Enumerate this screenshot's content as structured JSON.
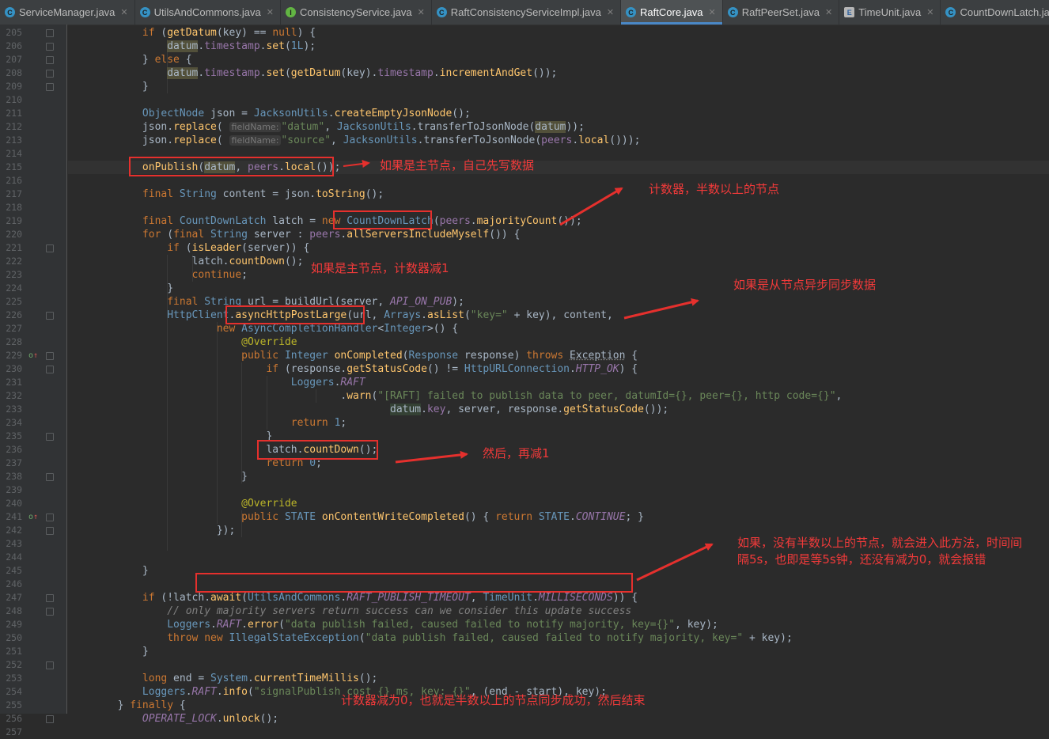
{
  "tabs": [
    {
      "name": "ServiceManager.java",
      "icon": "class",
      "active": false
    },
    {
      "name": "UtilsAndCommons.java",
      "icon": "class",
      "active": false
    },
    {
      "name": "ConsistencyService.java",
      "icon": "iface",
      "active": false
    },
    {
      "name": "RaftConsistencyServiceImpl.java",
      "icon": "class",
      "active": false
    },
    {
      "name": "RaftCore.java",
      "icon": "class",
      "active": true
    },
    {
      "name": "RaftPeerSet.java",
      "icon": "class",
      "active": false
    },
    {
      "name": "TimeUnit.java",
      "icon": "enum",
      "active": false
    },
    {
      "name": "CountDownLatch.java",
      "icon": "class",
      "active": false
    }
  ],
  "line_numbers": [
    "205",
    "206",
    "207",
    "208",
    "209",
    "210",
    "211",
    "212",
    "213",
    "214",
    "215",
    "216",
    "217",
    "218",
    "219",
    "220",
    "221",
    "222",
    "223",
    "224",
    "225",
    "226",
    "227",
    "228",
    "229",
    "230",
    "231",
    "232",
    "233",
    "234",
    "235",
    "236",
    "237",
    "238",
    "239",
    "240",
    "241",
    "242",
    "243",
    "244",
    "245",
    "246",
    "247",
    "248",
    "249",
    "250",
    "251",
    "252",
    "253",
    "254",
    "255",
    "256",
    "257"
  ],
  "code_lines": [
    [
      [
        "",
        "            "
      ],
      [
        "k",
        "if"
      ],
      [
        "",
        " ("
      ],
      [
        "m",
        "getDatum"
      ],
      [
        "",
        "(key) == "
      ],
      [
        "k",
        "null"
      ],
      [
        "",
        ") {"
      ]
    ],
    [
      [
        "",
        "                "
      ],
      [
        "hl",
        "datum"
      ],
      [
        "",
        "."
      ],
      [
        "f",
        "timestamp"
      ],
      [
        "",
        "."
      ],
      [
        "m",
        "set"
      ],
      [
        "",
        "("
      ],
      [
        "n",
        "1L"
      ],
      [
        "",
        ");"
      ]
    ],
    [
      [
        "",
        "            } "
      ],
      [
        "k",
        "else"
      ],
      [
        "",
        " {"
      ]
    ],
    [
      [
        "",
        "                "
      ],
      [
        "hl",
        "datum"
      ],
      [
        "",
        "."
      ],
      [
        "f",
        "timestamp"
      ],
      [
        "",
        "."
      ],
      [
        "m",
        "set"
      ],
      [
        "",
        "("
      ],
      [
        "m",
        "getDatum"
      ],
      [
        "",
        "(key)."
      ],
      [
        "f",
        "timestamp"
      ],
      [
        "",
        "."
      ],
      [
        "m",
        "incrementAndGet"
      ],
      [
        "",
        "());"
      ]
    ],
    [
      [
        "",
        "            }"
      ]
    ],
    [],
    [
      [
        "",
        "            "
      ],
      [
        "t",
        "ObjectNode"
      ],
      [
        "",
        " json = "
      ],
      [
        "t",
        "JacksonUtils"
      ],
      [
        "",
        "."
      ],
      [
        "m",
        "createEmptyJsonNode"
      ],
      [
        "",
        "();"
      ]
    ],
    [
      [
        "",
        "            json."
      ],
      [
        "m",
        "replace"
      ],
      [
        "",
        "( "
      ],
      [
        "hint",
        "fieldName:"
      ],
      [
        "",
        ""
      ],
      [
        "s",
        "\"datum\""
      ],
      [
        "",
        ", "
      ],
      [
        "t",
        "JacksonUtils"
      ],
      [
        "",
        ".transferToJsonNode("
      ],
      [
        "hl",
        "datum"
      ],
      [
        "",
        "));"
      ]
    ],
    [
      [
        "",
        "            json."
      ],
      [
        "m",
        "replace"
      ],
      [
        "",
        "( "
      ],
      [
        "hint",
        "fieldName:"
      ],
      [
        "",
        ""
      ],
      [
        "s",
        "\"source\""
      ],
      [
        "",
        ", "
      ],
      [
        "t",
        "JacksonUtils"
      ],
      [
        "",
        ".transferToJsonNode("
      ],
      [
        "f",
        "peers"
      ],
      [
        "",
        "."
      ],
      [
        "m",
        "local"
      ],
      [
        "",
        "()));"
      ]
    ],
    [],
    [
      [
        "",
        "            "
      ],
      [
        "m",
        "onPublish"
      ],
      [
        "",
        "("
      ],
      [
        "hl",
        "datum"
      ],
      [
        "",
        ", "
      ],
      [
        "f",
        "peers"
      ],
      [
        "",
        "."
      ],
      [
        "m",
        "local"
      ],
      [
        "",
        "());"
      ]
    ],
    [],
    [
      [
        "",
        "            "
      ],
      [
        "k",
        "final"
      ],
      [
        "",
        " "
      ],
      [
        "t",
        "String"
      ],
      [
        "",
        " content = json."
      ],
      [
        "m",
        "toString"
      ],
      [
        "",
        "();"
      ]
    ],
    [],
    [
      [
        "",
        "            "
      ],
      [
        "k",
        "final"
      ],
      [
        "",
        " "
      ],
      [
        "t",
        "CountDownLatch"
      ],
      [
        "",
        " latch = "
      ],
      [
        "k",
        "new"
      ],
      [
        "",
        " "
      ],
      [
        "t",
        "CountDownLatch"
      ],
      [
        "",
        "("
      ],
      [
        "f",
        "peers"
      ],
      [
        "",
        "."
      ],
      [
        "m",
        "majorityCount"
      ],
      [
        "",
        "());"
      ]
    ],
    [
      [
        "",
        "            "
      ],
      [
        "k",
        "for"
      ],
      [
        "",
        " ("
      ],
      [
        "k",
        "final"
      ],
      [
        "",
        " "
      ],
      [
        "t",
        "String"
      ],
      [
        "",
        " server : "
      ],
      [
        "f",
        "peers"
      ],
      [
        "",
        "."
      ],
      [
        "m",
        "allServersIncludeMyself"
      ],
      [
        "",
        "()) {"
      ]
    ],
    [
      [
        "",
        "                "
      ],
      [
        "k",
        "if"
      ],
      [
        "",
        " ("
      ],
      [
        "m",
        "isLeader"
      ],
      [
        "",
        "(server)) {"
      ]
    ],
    [
      [
        "",
        "                    latch."
      ],
      [
        "m",
        "countDown"
      ],
      [
        "",
        "();"
      ]
    ],
    [
      [
        "",
        "                    "
      ],
      [
        "k",
        "continue"
      ],
      [
        "",
        ";"
      ]
    ],
    [
      [
        "",
        "                }"
      ]
    ],
    [
      [
        "",
        "                "
      ],
      [
        "k",
        "final"
      ],
      [
        "",
        " "
      ],
      [
        "t",
        "String"
      ],
      [
        "",
        " url = buildUrl(server, "
      ],
      [
        "sf",
        "API_ON_PUB"
      ],
      [
        "",
        ");"
      ]
    ],
    [
      [
        "",
        "                "
      ],
      [
        "t",
        "HttpClient"
      ],
      [
        "",
        "."
      ],
      [
        "m",
        "asyncHttpPostLarge"
      ],
      [
        "",
        "(url, "
      ],
      [
        "t",
        "Arrays"
      ],
      [
        "",
        "."
      ],
      [
        "m",
        "asList"
      ],
      [
        "",
        "("
      ],
      [
        "s",
        "\"key=\""
      ],
      [
        "",
        " + key), content,"
      ]
    ],
    [
      [
        "",
        "                        "
      ],
      [
        "k",
        "new"
      ],
      [
        "",
        " "
      ],
      [
        "t",
        "AsyncCompletionHandler"
      ],
      [
        "",
        "<"
      ],
      [
        "t",
        "Integer"
      ],
      [
        "",
        ">() {"
      ]
    ],
    [
      [
        "",
        "                            "
      ],
      [
        "a",
        "@Override"
      ]
    ],
    [
      [
        "",
        "                            "
      ],
      [
        "k",
        "public"
      ],
      [
        "",
        " "
      ],
      [
        "t",
        "Integer"
      ],
      [
        "",
        " "
      ],
      [
        "m",
        "onCompleted"
      ],
      [
        "",
        "("
      ],
      [
        "t",
        "Response"
      ],
      [
        "",
        " response) "
      ],
      [
        "k",
        "throws"
      ],
      [
        "",
        " "
      ],
      [
        "ex",
        "Exception"
      ],
      [
        "",
        " {"
      ]
    ],
    [
      [
        "",
        "                                "
      ],
      [
        "k",
        "if"
      ],
      [
        "",
        " (response."
      ],
      [
        "m",
        "getStatusCode"
      ],
      [
        "",
        "() != "
      ],
      [
        "t",
        "HttpURLConnection"
      ],
      [
        "",
        "."
      ],
      [
        "sf",
        "HTTP_OK"
      ],
      [
        "",
        ") {"
      ]
    ],
    [
      [
        "",
        "                                    "
      ],
      [
        "t",
        "Loggers"
      ],
      [
        "",
        "."
      ],
      [
        "sf",
        "RAFT"
      ]
    ],
    [
      [
        "",
        "                                            ."
      ],
      [
        "m",
        "warn"
      ],
      [
        "",
        "("
      ],
      [
        "s",
        "\"[RAFT] failed to publish data to peer, datumId={}, peer={}, http code={}\""
      ],
      [
        "",
        ","
      ]
    ],
    [
      [
        "",
        "                                                    "
      ],
      [
        "hl2",
        "datum"
      ],
      [
        "",
        "."
      ],
      [
        "f",
        "key"
      ],
      [
        "",
        ", server, response."
      ],
      [
        "m",
        "getStatusCode"
      ],
      [
        "",
        "());"
      ]
    ],
    [
      [
        "",
        "                                    "
      ],
      [
        "k",
        "return"
      ],
      [
        "",
        " "
      ],
      [
        "n",
        "1"
      ],
      [
        "",
        ";"
      ]
    ],
    [
      [
        "",
        "                                }"
      ]
    ],
    [
      [
        "",
        "                                latch."
      ],
      [
        "m",
        "countDown"
      ],
      [
        "",
        "();"
      ]
    ],
    [
      [
        "",
        "                                "
      ],
      [
        "k",
        "return"
      ],
      [
        "",
        " "
      ],
      [
        "n",
        "0"
      ],
      [
        "",
        ";"
      ]
    ],
    [
      [
        "",
        "                            }"
      ]
    ],
    [],
    [
      [
        "",
        "                            "
      ],
      [
        "a",
        "@Override"
      ]
    ],
    [
      [
        "",
        "                            "
      ],
      [
        "k",
        "public"
      ],
      [
        "",
        " "
      ],
      [
        "t",
        "STATE"
      ],
      [
        "",
        " "
      ],
      [
        "m",
        "onContentWriteCompleted"
      ],
      [
        "",
        "() { "
      ],
      [
        "k",
        "return"
      ],
      [
        "",
        " "
      ],
      [
        "t",
        "STATE"
      ],
      [
        "",
        "."
      ],
      [
        "sf",
        "CONTINUE"
      ],
      [
        "",
        "; }"
      ]
    ],
    [
      [
        "",
        "                        });"
      ]
    ],
    [],
    [],
    [
      [
        "",
        "            }"
      ]
    ],
    [],
    [
      [
        "",
        "            "
      ],
      [
        "k",
        "if"
      ],
      [
        "",
        " (!latch."
      ],
      [
        "m",
        "await"
      ],
      [
        "",
        "("
      ],
      [
        "t",
        "UtilsAndCommons"
      ],
      [
        "",
        "."
      ],
      [
        "sf",
        "RAFT_PUBLISH_TIMEOUT"
      ],
      [
        "",
        ", "
      ],
      [
        "t",
        "TimeUnit"
      ],
      [
        "",
        "."
      ],
      [
        "sf",
        "MILLISECONDS"
      ],
      [
        "",
        ")) {"
      ]
    ],
    [
      [
        "",
        "                "
      ],
      [
        "c",
        "// only majority servers return success can we consider this update success"
      ]
    ],
    [
      [
        "",
        "                "
      ],
      [
        "t",
        "Loggers"
      ],
      [
        "",
        "."
      ],
      [
        "sf",
        "RAFT"
      ],
      [
        "",
        "."
      ],
      [
        "m",
        "error"
      ],
      [
        "",
        "("
      ],
      [
        "s",
        "\"data publish failed, caused failed to notify majority, key={}\""
      ],
      [
        "",
        ", key);"
      ]
    ],
    [
      [
        "",
        "                "
      ],
      [
        "k",
        "throw"
      ],
      [
        "",
        " "
      ],
      [
        "k",
        "new"
      ],
      [
        "",
        " "
      ],
      [
        "t",
        "IllegalStateException"
      ],
      [
        "",
        "("
      ],
      [
        "s",
        "\"data publish failed, caused failed to notify majority, key=\""
      ],
      [
        "",
        " + key);"
      ]
    ],
    [
      [
        "",
        "            }"
      ]
    ],
    [],
    [
      [
        "",
        "            "
      ],
      [
        "k",
        "long"
      ],
      [
        "",
        " end = "
      ],
      [
        "t",
        "System"
      ],
      [
        "",
        "."
      ],
      [
        "m",
        "currentTimeMillis"
      ],
      [
        "",
        "();"
      ]
    ],
    [
      [
        "",
        "            "
      ],
      [
        "t",
        "Loggers"
      ],
      [
        "",
        "."
      ],
      [
        "sf",
        "RAFT"
      ],
      [
        "",
        "."
      ],
      [
        "m",
        "info"
      ],
      [
        "",
        "("
      ],
      [
        "s",
        "\"signalPublish cost {} ms, key: {}\""
      ],
      [
        "",
        ", (end - start), key);"
      ]
    ],
    [
      [
        "",
        "        } "
      ],
      [
        "k",
        "finally"
      ],
      [
        "",
        " {"
      ]
    ],
    [
      [
        "",
        "            "
      ],
      [
        "sf",
        "OPERATE_LOCK"
      ],
      [
        "",
        "."
      ],
      [
        "m",
        "unlock"
      ],
      [
        "",
        "();"
      ]
    ]
  ],
  "annotations": {
    "note1": "如果是主节点，自己先写数据",
    "note2": "计数器，半数以上的节点",
    "note3": "如果是主节点，计数器减1",
    "note4": "如果是从节点异步同步数据",
    "note5": "然后，再减1",
    "note6a": "如果，没有半数以上的节点，就会进入此方法，时间间",
    "note6b": "隔5s，也即是等5s钟，还没有减为0，就会报错",
    "note7": "计数器减为0，也就是半数以上的节点同步成功，然后结束"
  },
  "colors": {
    "annotation": "#e5302d",
    "editor_bg": "#2b2b2b",
    "keyword": "#cc7832",
    "method": "#ffc66d",
    "string": "#6a8759"
  }
}
